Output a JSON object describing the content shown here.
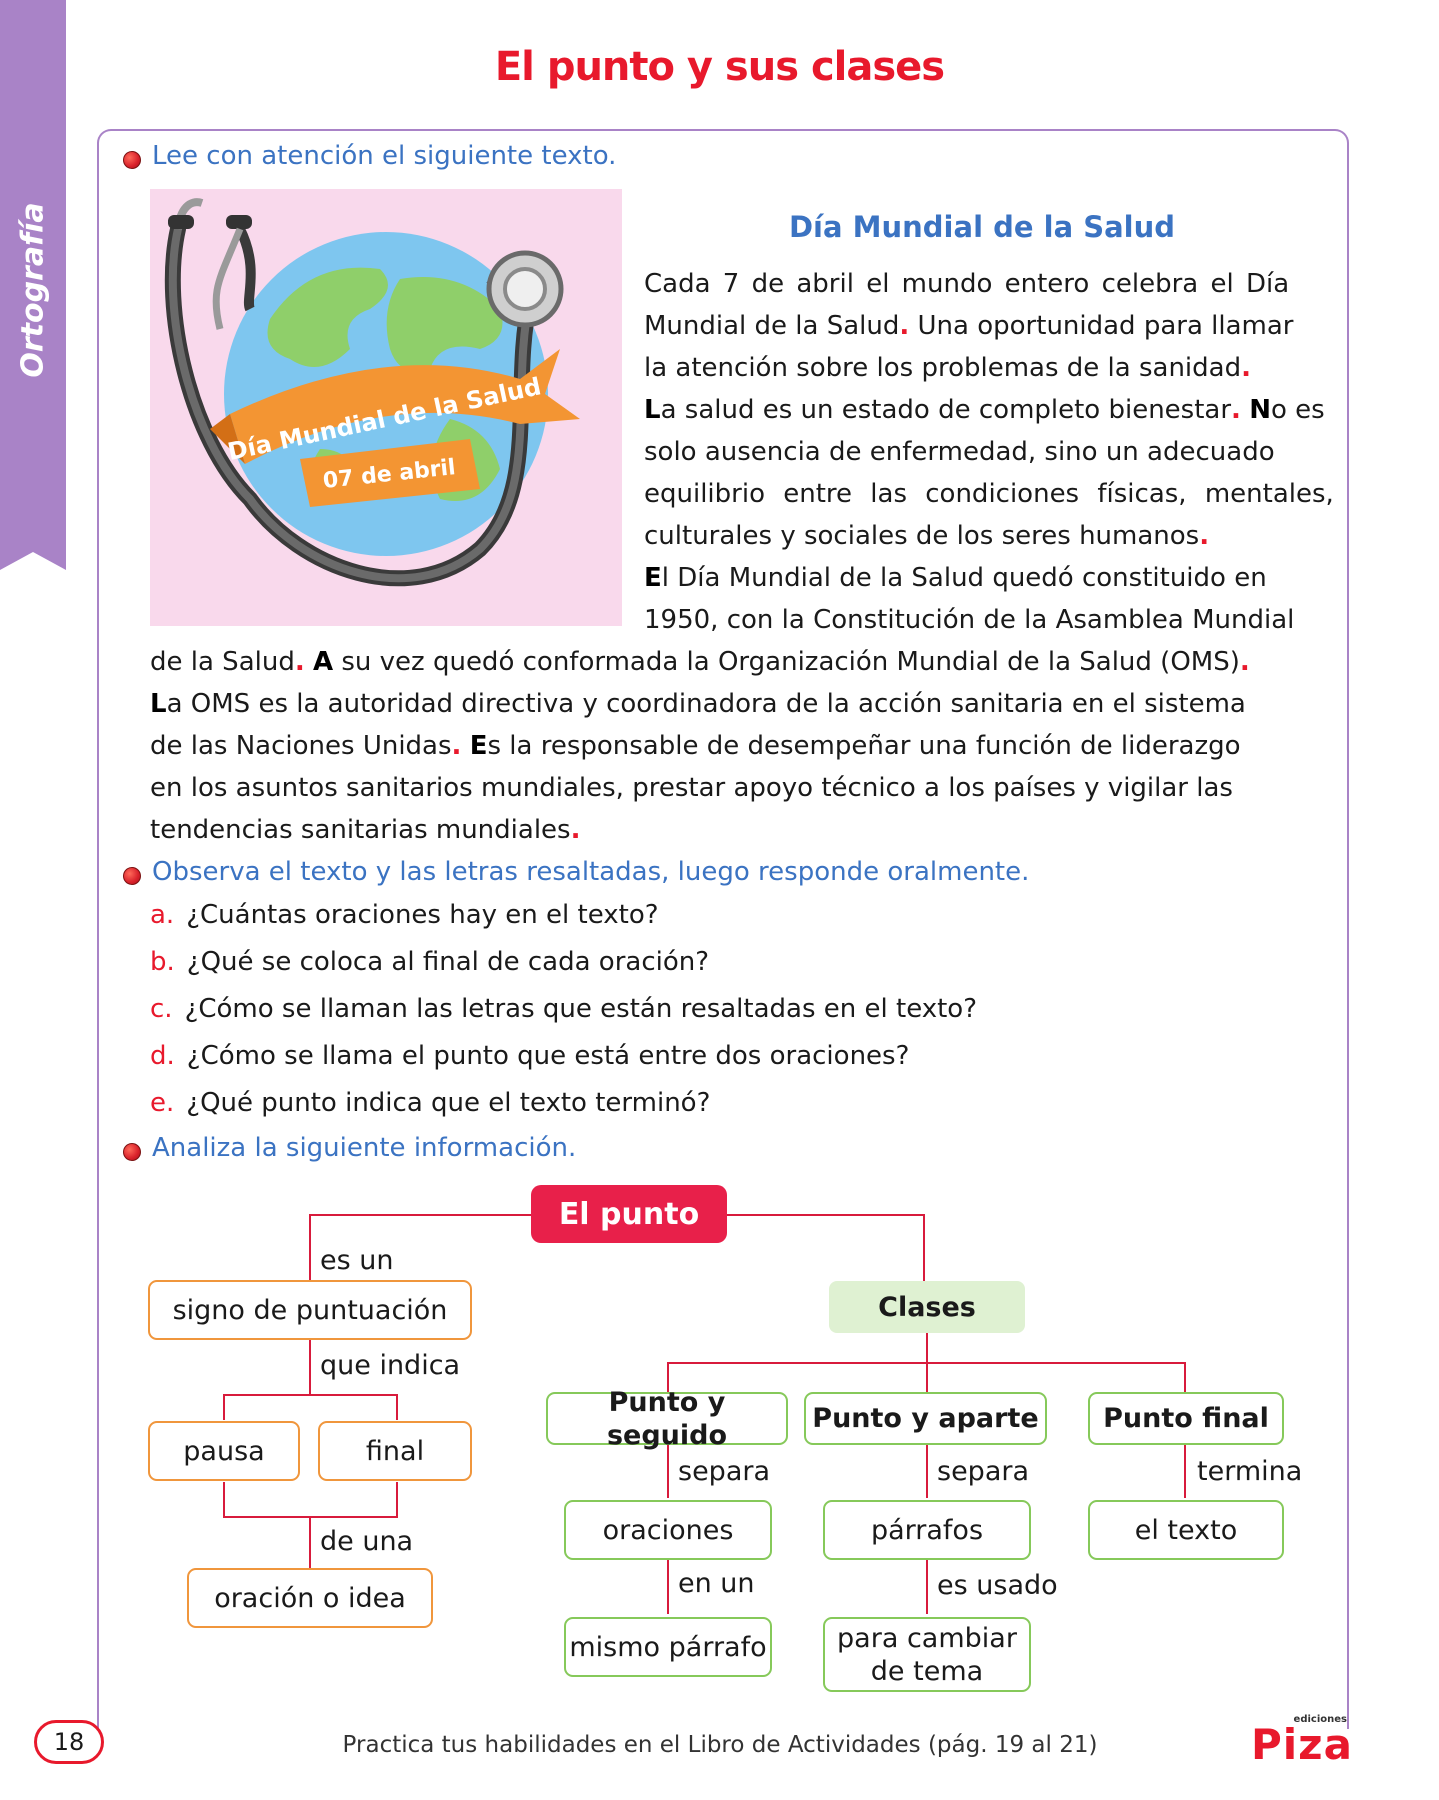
{
  "side_tab": {
    "label": "Ortografía",
    "color": "#a983c7"
  },
  "title": "El punto y sus clases",
  "instructions": {
    "read": "Lee con atención el siguiente texto.",
    "observe": "Observa el texto y las letras resaltadas, luego responde oralmente.",
    "analyze": "Analiza la siguiente información."
  },
  "illustration": {
    "banner_text": "Día Mundial de la Salud",
    "date_text": "07 de abril"
  },
  "article": {
    "title": "Día Mundial de la Salud",
    "lines": {
      "l1": "Cada 7 de abril el mundo entero celebra el Día",
      "l2a": "Mundial de la Salud",
      "l2b": " Una oportunidad para llamar",
      "l3": "la atención sobre los problemas de la sanidad",
      "l4a": "L",
      "l4b": "a salud es un estado de completo bienestar",
      "l4c": "N",
      "l4d": "o es",
      "l5": "solo ausencia de enfermedad, sino un adecuado",
      "l6": "equilibrio entre las condiciones físicas, mentales,",
      "l7": "culturales y sociales de los seres humanos",
      "l8a": "E",
      "l8b": "l Día Mundial de la Salud quedó constituido en",
      "l9": "1950, con la Constitución de la Asamblea Mundial",
      "l10a": "de la Salud",
      "l10b": "A",
      "l10c": " su vez quedó conformada la Organización Mundial de la Salud (OMS)",
      "l11a": "L",
      "l11b": "a OMS es la autoridad directiva y coordinadora de la acción sanitaria en el sistema",
      "l12a": "de las Naciones Unidas",
      "l12b": "E",
      "l12c": "s la responsable de desempeñar una función de liderazgo",
      "l13": "en los asuntos sanitarios mundiales, prestar apoyo técnico a los países y vigilar las",
      "l14": "tendencias sanitarias mundiales",
      "dot": "."
    }
  },
  "questions": [
    {
      "letter": "a.",
      "text": "¿Cuántas oraciones hay en el texto?"
    },
    {
      "letter": "b.",
      "text": "¿Qué se coloca al final de cada oración?"
    },
    {
      "letter": "c.",
      "text": "¿Cómo se llaman las letras que están resaltadas en el texto?"
    },
    {
      "letter": "d.",
      "text": "¿Cómo se llama el punto que está entre dos oraciones?"
    },
    {
      "letter": "e.",
      "text": "¿Qué punto indica que el texto terminó?"
    }
  ],
  "concept_map": {
    "root": "El punto",
    "es_un": "es un",
    "signo": "signo de puntuación",
    "que_indica": "que indica",
    "pausa": "pausa",
    "final": "final",
    "de_una": "de una",
    "oracion_idea": "oración o idea",
    "clases": "Clases",
    "seguido": "Punto y seguido",
    "aparte": "Punto y aparte",
    "punto_final": "Punto final",
    "separa1": "separa",
    "separa2": "separa",
    "termina": "termina",
    "oraciones": "oraciones",
    "parrafos": "párrafos",
    "el_texto": "el texto",
    "en_un": "en un",
    "es_usado": "es usado",
    "mismo_parrafo": "mismo párrafo",
    "cambiar_tema_1": "para cambiar",
    "cambiar_tema_2": "de tema"
  },
  "footer": {
    "page_number": "18",
    "text": "Practica tus habilidades en el Libro de Actividades (pág. 19 al 21)",
    "logo_top": "ediciones",
    "logo_main": "Piza"
  },
  "colors": {
    "red": "#e8192c",
    "blue": "#3b73c2",
    "purple": "#a983c7",
    "orange": "#f0963c",
    "green": "#86c95a"
  }
}
